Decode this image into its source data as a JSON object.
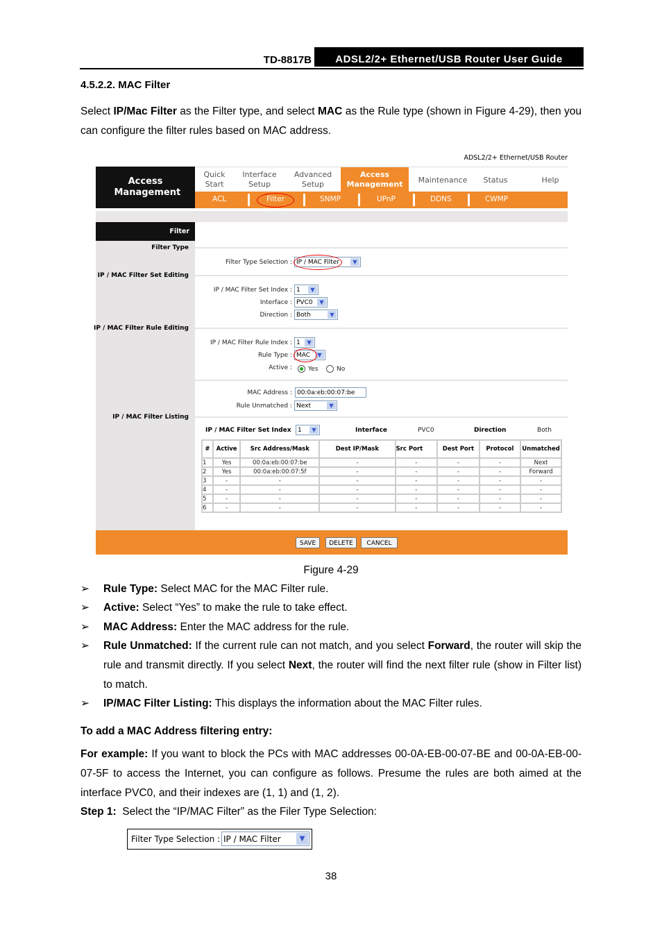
{
  "header": {
    "model": "TD-8817B",
    "guide_title": "ADSL2/2+ Ethernet/USB Router User Guide"
  },
  "section": {
    "number_title": "4.5.2.2.  MAC Filter"
  },
  "intro": {
    "p1": "Select ",
    "p1_b1": "IP/Mac Filter",
    "p2": " as the Filter type, and select ",
    "p2_b2": "MAC",
    "p3": " as the Rule type (shown in Figure 4-29), then you can configure the filter rules based on MAC address."
  },
  "figure": {
    "brand": "ADSL2/2+ Ethernet/USB Router",
    "section_block": "Access Management",
    "nav": [
      {
        "label": "Quick Start"
      },
      {
        "label": "Interface Setup"
      },
      {
        "label": "Advanced Setup"
      },
      {
        "label": "Access Management",
        "active": true
      },
      {
        "label": "Maintenance"
      },
      {
        "label": "Status"
      },
      {
        "label": "Help"
      }
    ],
    "subnav": [
      "ACL",
      "Filter",
      "SNMP",
      "UPnP",
      "DDNS",
      "CWMP"
    ],
    "filter_header": "Filter",
    "left_labels": {
      "filter_type": "Filter Type",
      "set_editing": "IP / MAC Filter Set Editing",
      "rule_editing": "IP / MAC Filter Rule Editing",
      "listing": "IP / MAC Filter Listing"
    },
    "fields": {
      "filter_type_selection": {
        "label": "Filter Type Selection :",
        "value": "IP / MAC Filter"
      },
      "set_index": {
        "label": "IP / MAC Filter Set Index :",
        "value": "1"
      },
      "interface": {
        "label": "Interface :",
        "value": "PVC0"
      },
      "direction": {
        "label": "Direction :",
        "value": "Both"
      },
      "rule_index": {
        "label": "IP / MAC Filter Rule Index :",
        "value": "1"
      },
      "rule_type": {
        "label": "Rule Type :",
        "value": "MAC"
      },
      "active": {
        "label": "Active :",
        "yes": "Yes",
        "no": "No",
        "selected": "Yes"
      },
      "mac_address": {
        "label": "MAC Address :",
        "value": "00:0a:eb:00:07:be"
      },
      "rule_unmatched": {
        "label": "Rule Unmatched :",
        "value": "Next"
      }
    },
    "listing": {
      "set_index_label": "IP / MAC Filter Set Index",
      "set_index_value": "1",
      "interface_label": "Interface",
      "interface_value": "PVC0",
      "direction_label": "Direction",
      "direction_value": "Both",
      "columns": [
        "#",
        "Active",
        "Src Address/Mask",
        "Dest IP/Mask",
        "Src Port",
        "Dest Port",
        "Protocol",
        "Unmatched"
      ],
      "rows": [
        [
          "1",
          "Yes",
          "00:0a:eb:00:07:be",
          "-",
          "-",
          "-",
          "-",
          "Next"
        ],
        [
          "2",
          "Yes",
          "00:0a:eb:00:07:5f",
          "-",
          "-",
          "-",
          "-",
          "Forward"
        ],
        [
          "3",
          "-",
          "-",
          "-",
          "-",
          "-",
          "-",
          "-"
        ],
        [
          "4",
          "-",
          "-",
          "-",
          "-",
          "-",
          "-",
          "-"
        ],
        [
          "5",
          "-",
          "-",
          "-",
          "-",
          "-",
          "-",
          "-"
        ],
        [
          "6",
          "-",
          "-",
          "-",
          "-",
          "-",
          "-",
          "-"
        ]
      ]
    },
    "buttons": {
      "save": "SAVE",
      "delete": "DELETE",
      "cancel": "CANCEL"
    },
    "caption": "Figure 4-29"
  },
  "bullets": [
    {
      "term": "Rule Type:",
      "text": " Select MAC for the MAC Filter rule."
    },
    {
      "term": "Active:",
      "text": " Select “Yes” to make the rule to take effect."
    },
    {
      "term": "MAC Address:",
      "text": " Enter the MAC address for the rule."
    },
    {
      "term": "Rule Unmatched:",
      "text1": " If the current rule can not match, and you select ",
      "b1": "Forward",
      "text2": ", the router will skip the rule and transmit directly. If you select ",
      "b2": "Next",
      "text3": ", the router will find the next filter rule (show in Filter list) to match."
    },
    {
      "term": "IP/MAC Filter Listing:",
      "text": " This displays the information about the MAC Filter rules."
    }
  ],
  "add_entry": {
    "heading": "To add a MAC Address filtering entry:",
    "example_label": "For example:",
    "example_text": " If you want to block the PCs with MAC addresses 00-0A-EB-00-07-BE and 00-0A-EB-00-07-5F to access the Internet, you can configure as follows. Presume the rules are both aimed at the interface PVC0, and their indexes are (1, 1) and (1, 2).",
    "step1_label": "Step 1:",
    "step1_text": "  Select the “IP/MAC Filter” as the Filer Type Selection:",
    "snippet_label": "Filter Type Selection :",
    "snippet_value": "IP / MAC Filter"
  },
  "page_number": "38"
}
